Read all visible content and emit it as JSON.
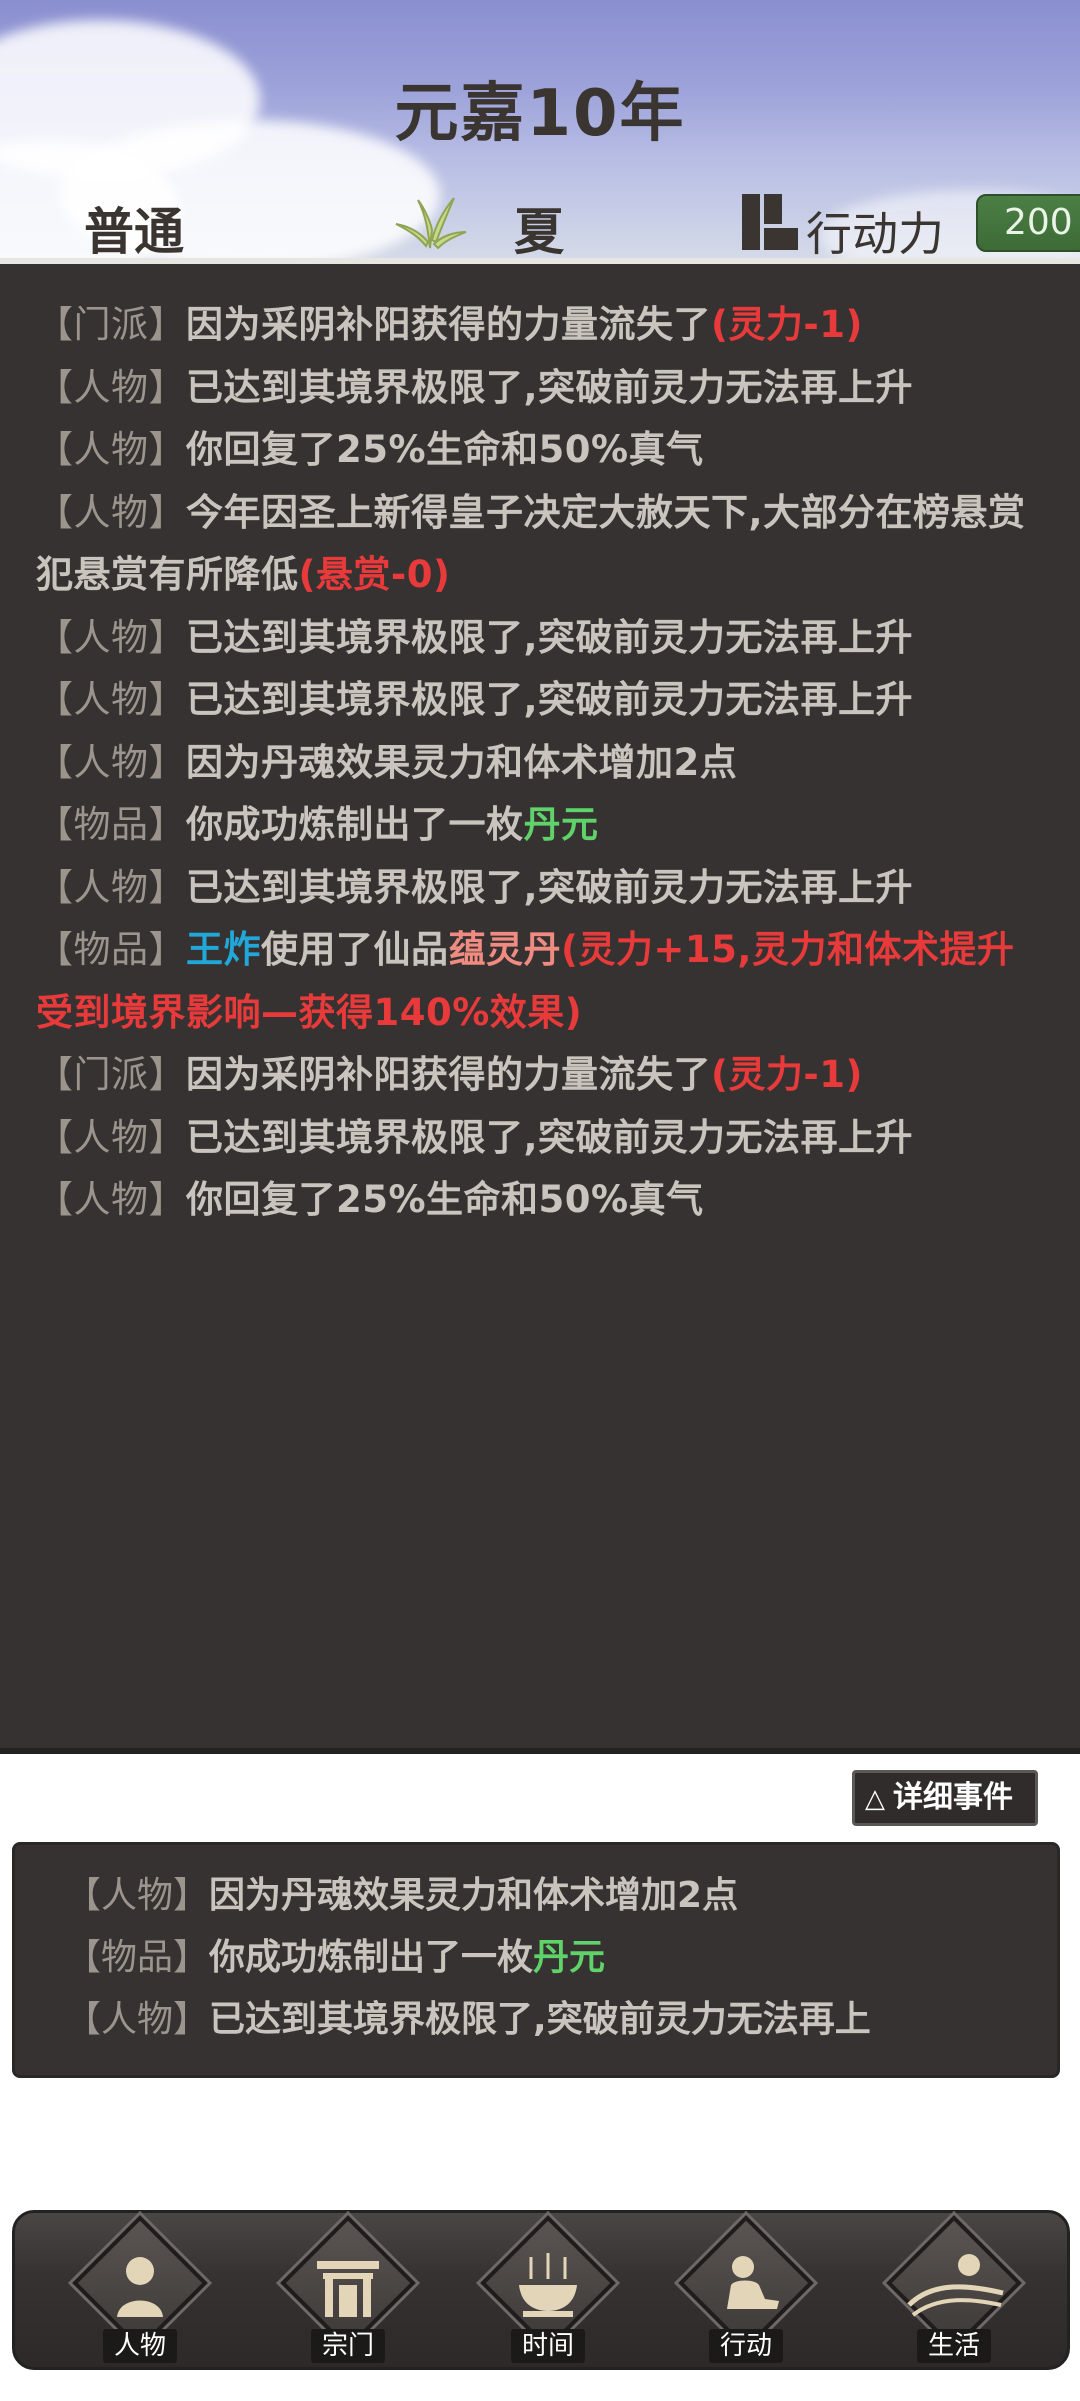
{
  "header": {
    "title": "元嘉10年",
    "mode": "普通",
    "season": "夏",
    "action_points_label": "行动力",
    "action_points_value": "200"
  },
  "log": [
    {
      "tag": "【门派】",
      "parts": [
        {
          "t": "因为采阴补阳获得的力量流失了",
          "c": ""
        },
        {
          "t": "(灵力-1)",
          "c": "red"
        }
      ]
    },
    {
      "tag": "【人物】",
      "parts": [
        {
          "t": "已达到其境界极限了,突破前灵力无法再上升",
          "c": ""
        }
      ]
    },
    {
      "tag": "【人物】",
      "parts": [
        {
          "t": "你回复了25%生命和50%真气",
          "c": ""
        }
      ]
    },
    {
      "tag": "【人物】",
      "parts": [
        {
          "t": "今年因圣上新得皇子决定大赦天下,大部分在榜悬赏犯悬赏有所降低",
          "c": ""
        },
        {
          "t": "(悬赏-0)",
          "c": "red"
        }
      ]
    },
    {
      "tag": "【人物】",
      "parts": [
        {
          "t": "已达到其境界极限了,突破前灵力无法再上升",
          "c": ""
        }
      ]
    },
    {
      "tag": "【人物】",
      "parts": [
        {
          "t": "已达到其境界极限了,突破前灵力无法再上升",
          "c": ""
        }
      ]
    },
    {
      "tag": "【人物】",
      "parts": [
        {
          "t": "因为丹魂效果灵力和体术增加2点",
          "c": ""
        }
      ]
    },
    {
      "tag": "【物品】",
      "parts": [
        {
          "t": "你成功炼制出了一枚",
          "c": ""
        },
        {
          "t": "丹元",
          "c": "green"
        }
      ]
    },
    {
      "tag": "【人物】",
      "parts": [
        {
          "t": "已达到其境界极限了,突破前灵力无法再上升",
          "c": ""
        }
      ]
    },
    {
      "tag": "【物品】",
      "parts": [
        {
          "t": "王炸",
          "c": "blue"
        },
        {
          "t": "使用了仙品",
          "c": ""
        },
        {
          "t": "蕴灵丹",
          "c": "pink"
        },
        {
          "t": "(灵力+15,灵力和体术提升受到境界影响—获得140%效果)",
          "c": "red"
        }
      ]
    },
    {
      "tag": "【门派】",
      "parts": [
        {
          "t": "因为采阴补阳获得的力量流失了",
          "c": ""
        },
        {
          "t": "(灵力-1)",
          "c": "red"
        }
      ]
    },
    {
      "tag": "【人物】",
      "parts": [
        {
          "t": "已达到其境界极限了,突破前灵力无法再上升",
          "c": ""
        }
      ]
    },
    {
      "tag": "【人物】",
      "parts": [
        {
          "t": "你回复了25%生命和50%真气",
          "c": ""
        }
      ]
    }
  ],
  "detail_button": {
    "icon": "triangle-icon",
    "label": "详细事件"
  },
  "summary": [
    {
      "tag": "【人物】",
      "parts": [
        {
          "t": "因为丹魂效果灵力和体术增加2点",
          "c": ""
        }
      ]
    },
    {
      "tag": "【物品】",
      "parts": [
        {
          "t": "你成功炼制出了一枚",
          "c": ""
        },
        {
          "t": "丹元",
          "c": "green"
        }
      ]
    },
    {
      "tag": "【人物】",
      "parts": [
        {
          "t": "已达到其境界极限了,突破前灵力无法再上",
          "c": ""
        }
      ]
    }
  ],
  "nav": [
    {
      "id": "character",
      "label": "人物",
      "icon": "person-icon"
    },
    {
      "id": "sect",
      "label": "宗门",
      "icon": "gate-icon"
    },
    {
      "id": "time",
      "label": "时间",
      "icon": "incense-burner-icon"
    },
    {
      "id": "action",
      "label": "行动",
      "icon": "meditate-icon"
    },
    {
      "id": "life",
      "label": "生活",
      "icon": "landscape-sun-icon"
    }
  ],
  "colors": {
    "panel_bg": "#363231",
    "text": "#c9c4bd",
    "tag": "#9b958d",
    "red": "#e83a3a",
    "green": "#5fd36a",
    "blue": "#22a7d9",
    "pink": "#f08b82",
    "ap_badge": "#4b7f44"
  }
}
